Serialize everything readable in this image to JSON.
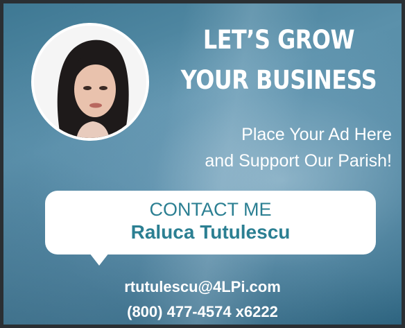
{
  "headline": {
    "line1": "LET’S GROW",
    "line2": "YOUR BUSINESS"
  },
  "subtitle": {
    "line1": "Place Your Ad Here",
    "line2": "and Support Our Parish!"
  },
  "contact_box": {
    "label": "CONTACT ME",
    "name": "Raluca Tutulescu"
  },
  "contact": {
    "email": "rtutulescu@4LPi.com",
    "phone": "(800) 477-4574 x6222"
  },
  "colors": {
    "accent": "#2b7f92",
    "background": "#4f86a1",
    "text": "#ffffff"
  }
}
